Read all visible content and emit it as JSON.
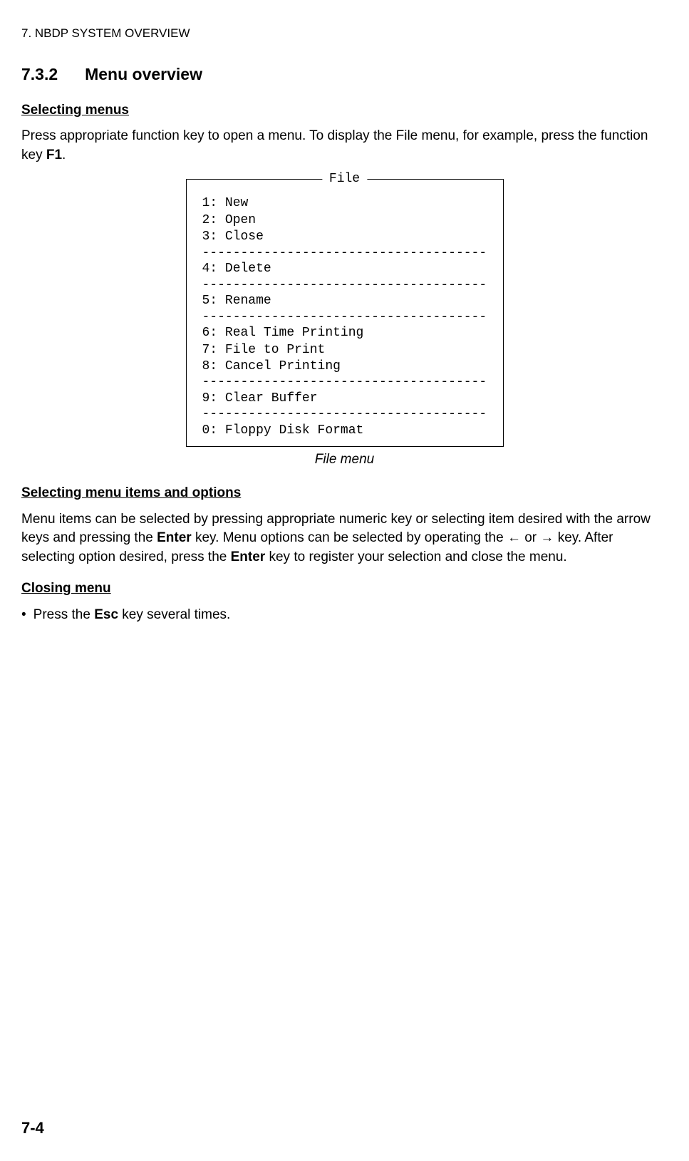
{
  "header": "7. NBDP SYSTEM OVERVIEW",
  "section": {
    "number": "7.3.2",
    "title": "Menu overview"
  },
  "sub1": {
    "heading": "Selecting menus",
    "text_before": "Press appropriate function key to open a menu. To display the File menu, for example, press the function key ",
    "key": "F1",
    "text_after": "."
  },
  "menu": {
    "title": "File",
    "items": {
      "i1": "1: New",
      "i2": "2: Open",
      "i3": "3: Close",
      "i4": "4: Delete",
      "i5": "5: Rename",
      "i6": "6: Real Time Printing",
      "i7": "7: File to Print",
      "i8": "8: Cancel Printing",
      "i9": "9: Clear Buffer",
      "i0": "0: Floppy Disk Format"
    },
    "caption": "File menu"
  },
  "sub2": {
    "heading": "Selecting menu items and options",
    "p1a": "Menu items can be selected by pressing appropriate numeric key or selecting item desired with the arrow keys and pressing the ",
    "p1b": "Enter",
    "p1c": " key. Menu options can be selected by operating the ← or → key. After selecting option desired, press the ",
    "p1d": "Enter",
    "p1e": " key to register your selection and close the menu."
  },
  "sub3": {
    "heading": "Closing menu",
    "bullet_a": "Press the ",
    "bullet_b": "Esc",
    "bullet_c": " key several times."
  },
  "page_number": "7-4",
  "dashes": "------------------------------------------"
}
